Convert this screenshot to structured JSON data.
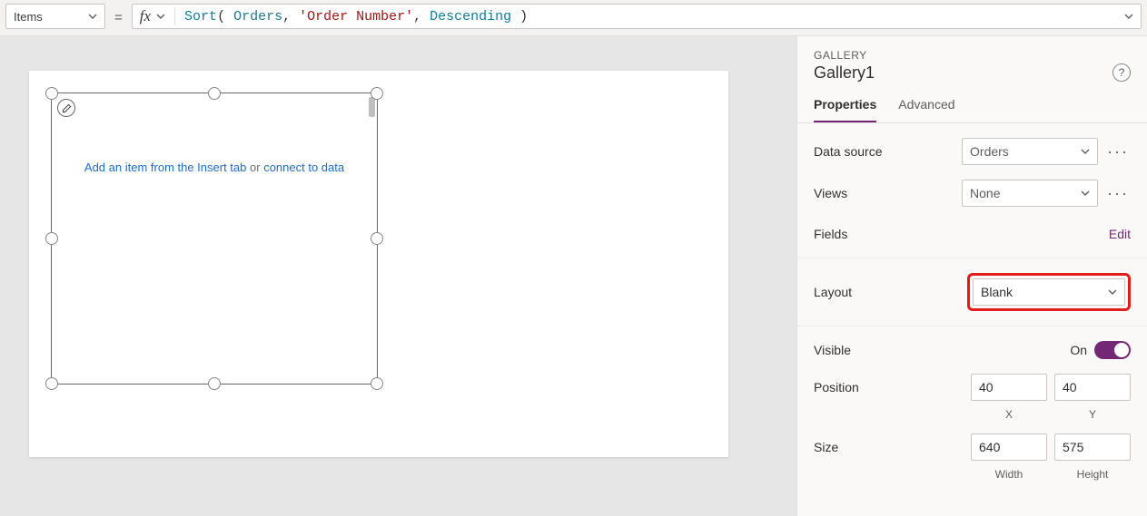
{
  "formulaBar": {
    "propertyName": "Items",
    "equals": "=",
    "fx": "fx",
    "expr": {
      "fn": "Sort",
      "open": "( ",
      "arg1": "Orders",
      "comma1": ", ",
      "arg2": "'Order Number'",
      "comma2": ", ",
      "arg3": "Descending",
      "close": " )"
    }
  },
  "canvas": {
    "emptyGallery": {
      "part1": "Add an item from the Insert tab",
      "part2": " or ",
      "part3": "connect to data"
    }
  },
  "panel": {
    "type": "GALLERY",
    "name": "Gallery1",
    "tabs": {
      "properties": "Properties",
      "advanced": "Advanced"
    },
    "dataSource": {
      "label": "Data source",
      "value": "Orders"
    },
    "views": {
      "label": "Views",
      "value": "None"
    },
    "fields": {
      "label": "Fields",
      "link": "Edit"
    },
    "layout": {
      "label": "Layout",
      "value": "Blank"
    },
    "visible": {
      "label": "Visible",
      "state": "On"
    },
    "position": {
      "label": "Position",
      "x": "40",
      "y": "40",
      "xLabel": "X",
      "yLabel": "Y"
    },
    "size": {
      "label": "Size",
      "w": "640",
      "h": "575",
      "wLabel": "Width",
      "hLabel": "Height"
    }
  }
}
